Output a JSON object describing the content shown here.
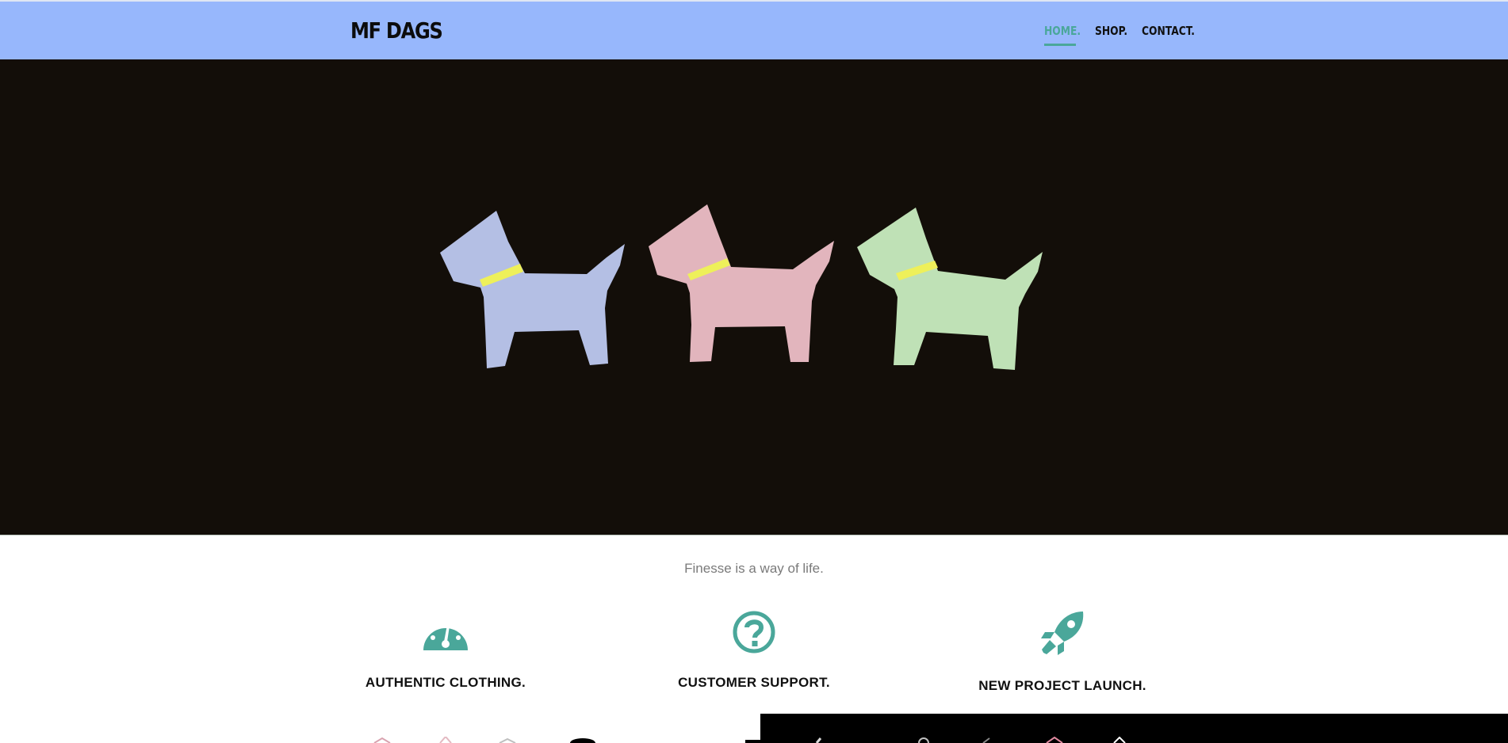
{
  "header": {
    "logo": "MF DAGS",
    "nav": [
      {
        "label": "HOME.",
        "active": true
      },
      {
        "label": "SHOP.",
        "active": false
      },
      {
        "label": "CONTACT.",
        "active": false
      }
    ]
  },
  "hero": {
    "dogs": [
      {
        "name": "dog-blue",
        "color": "#b4bfe4"
      },
      {
        "name": "dog-pink",
        "color": "#e2b5bd"
      },
      {
        "name": "dog-green",
        "color": "#bfe1b6"
      }
    ],
    "collar_color": "#eef05a",
    "background": "#130e09"
  },
  "tagline": "Finesse is a way of life.",
  "features": [
    {
      "icon": "speedometer-icon",
      "title": "AUTHENTIC CLOTHING."
    },
    {
      "icon": "question-circle-icon",
      "title": "CUSTOMER SUPPORT."
    },
    {
      "icon": "rocket-icon",
      "title": "NEW PROJECT LAUNCH."
    }
  ],
  "colors": {
    "header_bg": "#97b7fc",
    "accent": "#4aa79a",
    "text_dark": "#111111",
    "tagline": "#7a7a7a"
  }
}
